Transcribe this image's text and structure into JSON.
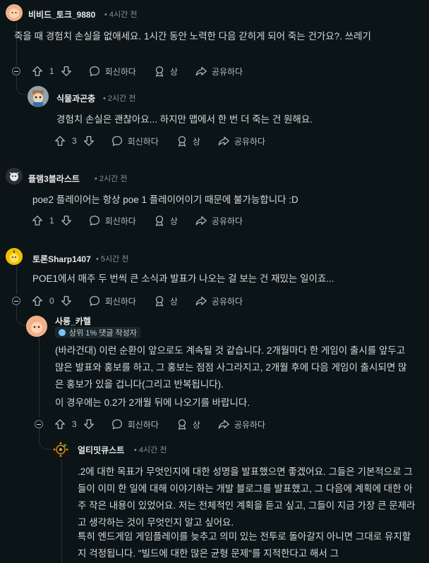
{
  "actions": {
    "reply": "회신하다",
    "award": "상",
    "share": "공유하다"
  },
  "comments": [
    {
      "username": "비비드_토크_9880",
      "time": "4시간 전",
      "body": "죽을 때 경험치 손실을 없애세요. 1시간 동안 노력한 다음 갇히게 되어 죽는 건가요?. 쓰레기",
      "votes": "1"
    },
    {
      "username": "식물과곤충",
      "time": "2시간 전",
      "body": "경험치 손실은 괜찮아요... 하지만 맵에서 한 번 더 죽는 건 원해요.",
      "votes": "3"
    },
    {
      "username": "플램3블라스트",
      "time": "2시간 전",
      "body": "poe2 플레이어는 항상 poe 1 플레이어이기 때문에 불가능합니다 :D",
      "votes": "1"
    },
    {
      "username": "토론Sharp1407",
      "time": "5시간 전",
      "body": "POE1에서 매주 두 번씩 큰 소식과 발표가 나오는 걸 보는 건 재밌는 일이죠...",
      "votes": "0"
    },
    {
      "username": "사릉_카헬",
      "flair": "상위 1% 댓글 작성자",
      "body_p1": "(바라건대) 이런 순환이 앞으로도 계속될 것 같습니다. 2개월마다 한 게임이 출시를 앞두고 많은 발표와 홍보를 하고, 그 홍보는 점점 사그라지고, 2개월 후에 다음 게임이 출시되면 많은 홍보가 있을 겁니다(그리고 반복됩니다).",
      "body_p2": "이 경우에는 0.2가 2개월 뒤에 나오기를 바랍니다.",
      "votes": "3"
    },
    {
      "username": "얼티밋큐스트",
      "time": "4시간 전",
      "body_p1": ".2에 대한 목표가 무엇인지에 대한 성명을 발표했으면 좋겠어요. 그들은 기본적으로 그들이 이미 한 일에 대해 이야기하는 개발 블로그를 발표했고, 그 다음에 계획에 대한 아주 작은 내용이 있었어요. 저는 전체적인 계획을 듣고 싶고, 그들이 지금 가장 큰 문제라고 생각하는 것이 무엇인지 알고 싶어요.",
      "body_p2": "특히 엔드게임 게임플레이를 늦추고 의미 있는 전투로 돌아갈지 아니면 그대로 유지할지 걱정됩니다. \"빌드에 대한 많은 균형 문제\"를 지적한다고 해서 그"
    }
  ]
}
